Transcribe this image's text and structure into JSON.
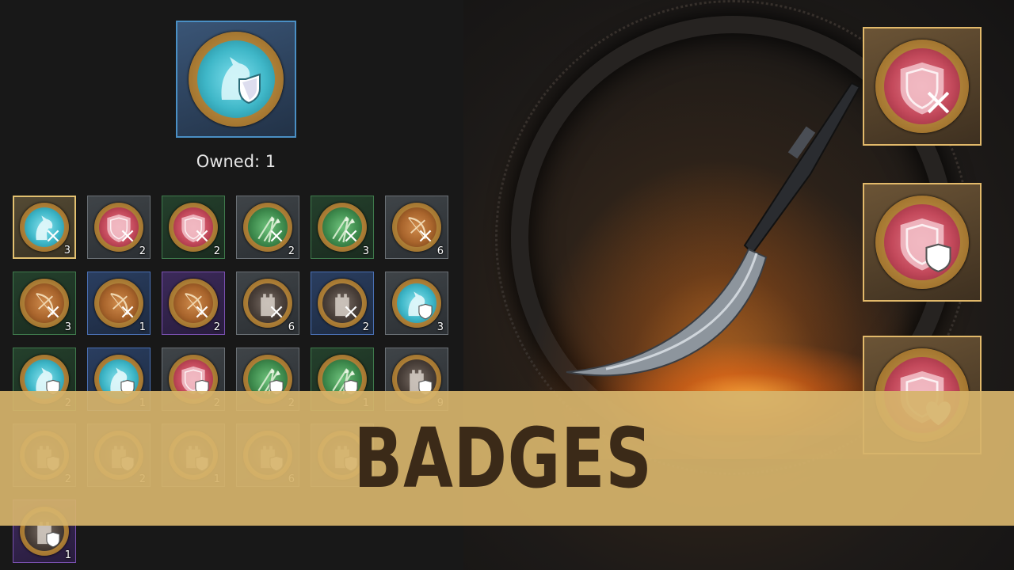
{
  "featured": {
    "icon": "horse-shield-icon",
    "owned_label": "Owned: 1"
  },
  "grid": [
    {
      "icon": "horse-swords-icon",
      "tint": "cyan",
      "quality": "gold",
      "count": "3"
    },
    {
      "icon": "shield-swords-icon",
      "tint": "red",
      "quality": "gray",
      "count": "2"
    },
    {
      "icon": "shield-swords-icon",
      "tint": "red",
      "quality": "green",
      "count": "2"
    },
    {
      "icon": "spears-swords-icon",
      "tint": "green",
      "quality": "gray",
      "count": "2"
    },
    {
      "icon": "spears-swords-icon",
      "tint": "green",
      "quality": "green",
      "count": "3"
    },
    {
      "icon": "bow-swords-icon",
      "tint": "brown",
      "quality": "gray",
      "count": "6"
    },
    {
      "icon": "bow-swords-icon",
      "tint": "brown",
      "quality": "green",
      "count": "3"
    },
    {
      "icon": "bow-swords-icon",
      "tint": "brown",
      "quality": "blue",
      "count": "1"
    },
    {
      "icon": "bow-swords-icon",
      "tint": "brown",
      "quality": "purple",
      "count": "2"
    },
    {
      "icon": "tower-swords-icon",
      "tint": "dark",
      "quality": "gray",
      "count": "6"
    },
    {
      "icon": "tower-swords-icon",
      "tint": "dark",
      "quality": "blue",
      "count": "2"
    },
    {
      "icon": "horse-shield-icon",
      "tint": "cyan",
      "quality": "gray",
      "count": "3"
    },
    {
      "icon": "horse-shield-icon",
      "tint": "cyan",
      "quality": "green",
      "count": "2"
    },
    {
      "icon": "horse-shield-icon",
      "tint": "cyan",
      "quality": "blue",
      "count": "1"
    },
    {
      "icon": "shield-shield-icon",
      "tint": "red",
      "quality": "gray",
      "count": "2"
    },
    {
      "icon": "spears-shield-icon",
      "tint": "green",
      "quality": "gray",
      "count": "2"
    },
    {
      "icon": "spears-shield-icon",
      "tint": "green",
      "quality": "green",
      "count": "1"
    },
    {
      "icon": "tower-shield-icon",
      "tint": "dark",
      "quality": "gray",
      "count": "9"
    },
    {
      "icon": "tower-shield-icon",
      "tint": "dark",
      "quality": "gray",
      "count": "2"
    },
    {
      "icon": "tower-shield-icon",
      "tint": "dark",
      "quality": "gray",
      "count": "2"
    },
    {
      "icon": "tower-shield-icon",
      "tint": "dark",
      "quality": "gray",
      "count": "1"
    },
    {
      "icon": "tower-shield-icon",
      "tint": "dark",
      "quality": "gray",
      "count": "6"
    },
    {
      "icon": "tower-shield-icon",
      "tint": "dark",
      "quality": "gray",
      "count": ""
    },
    {
      "icon": "tower-shield-icon",
      "tint": "dark",
      "quality": "purple",
      "count": "1"
    }
  ],
  "side_badges": [
    {
      "icon": "shield-swords-icon",
      "tint": "red"
    },
    {
      "icon": "shield-shield-icon",
      "tint": "red"
    },
    {
      "icon": "shield-heart-icon",
      "tint": "red"
    }
  ],
  "banner": {
    "title": "BADGES"
  },
  "colors": {
    "cyan": "#3fb7c8",
    "red": "#c44a5c",
    "green": "#3f8c4e",
    "brown": "#a8642c",
    "dark": "#4a403a",
    "banner": "#d6b46c",
    "banner_text": "#3b2a18"
  }
}
